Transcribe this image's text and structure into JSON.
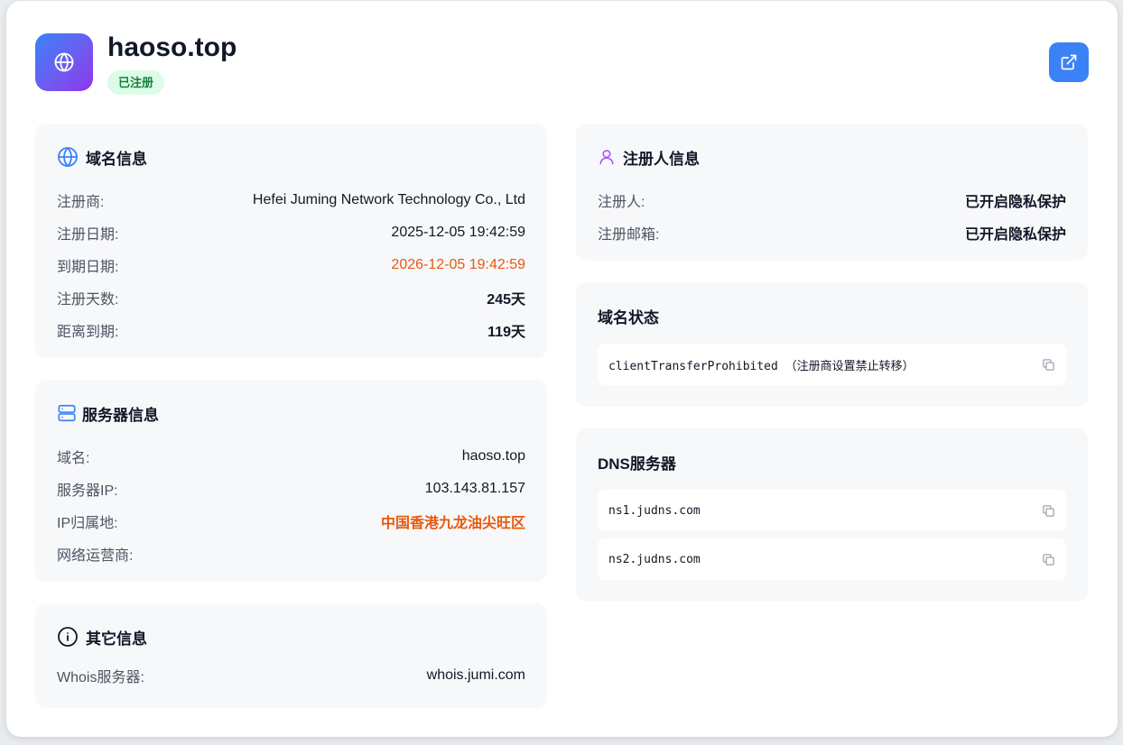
{
  "header": {
    "domain": "haoso.top",
    "status": "已注册",
    "icons": {
      "logo": "globe-icon",
      "open": "external-link-icon"
    }
  },
  "domain_info": {
    "title": "域名信息",
    "icon": "globe-icon",
    "rows": [
      {
        "label": "注册商:",
        "value": "Hefei Juming Network Technology Co., Ltd"
      },
      {
        "label": "注册日期:",
        "value": "2025-12-05 19:42:59"
      },
      {
        "label": "到期日期:",
        "value": "2026-12-05 19:42:59"
      },
      {
        "label": "注册天数:",
        "value": "245天"
      },
      {
        "label": "距离到期:",
        "value": "119天"
      }
    ]
  },
  "server_info": {
    "title": "服务器信息",
    "icon": "server-icon",
    "rows": [
      {
        "label": "域名:",
        "value": "haoso.top"
      },
      {
        "label": "服务器IP:",
        "value": "103.143.81.157"
      },
      {
        "label": "IP归属地:",
        "value": "中国香港九龙油尖旺区"
      },
      {
        "label": "网络运营商:",
        "value": ""
      }
    ]
  },
  "other_info": {
    "title": "其它信息",
    "icon": "info-icon",
    "rows": [
      {
        "label": "Whois服务器:",
        "value": "whois.jumi.com"
      }
    ]
  },
  "registrant_info": {
    "title": "注册人信息",
    "icon": "user-icon",
    "rows": [
      {
        "label": "注册人:",
        "value": "已开启隐私保护"
      },
      {
        "label": "注册邮箱:",
        "value": "已开启隐私保护"
      }
    ]
  },
  "domain_status": {
    "title": "域名状态",
    "items": [
      "clientTransferProhibited （注册商设置禁止转移）"
    ]
  },
  "dns_servers": {
    "title": "DNS服务器",
    "items": [
      "ns1.judns.com",
      "ns2.judns.com"
    ]
  },
  "colors": {
    "accent": "#3b82f6",
    "warning": "#ea580c",
    "success_bg": "#dcfce7",
    "success_text": "#15803d",
    "registrant_icon": "#a855f7"
  }
}
